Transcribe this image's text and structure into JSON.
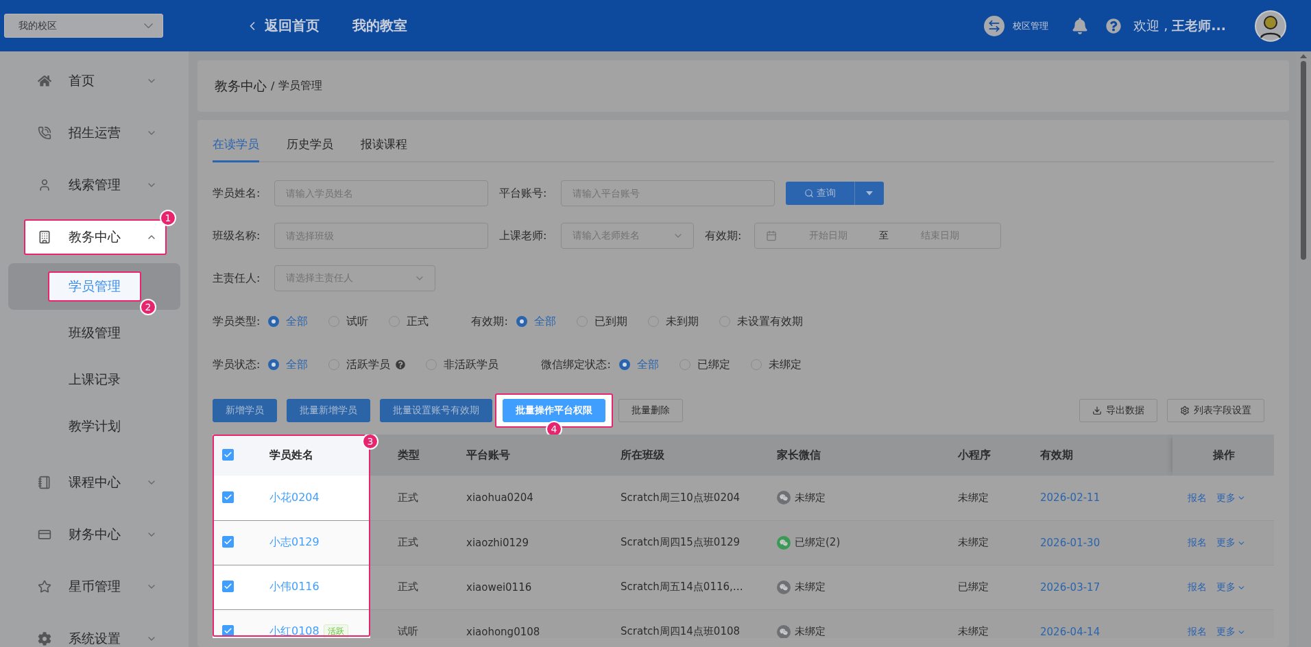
{
  "header": {
    "campus_select": "我的校区",
    "back": "返回首页",
    "nav_item": "我的教室",
    "campus_manage": "校区管理",
    "welcome": "欢迎 , **王老师...**"
  },
  "sidebar": [
    {
      "label": "首页",
      "expanded": false
    },
    {
      "label": "招生运营",
      "expanded": false
    },
    {
      "label": "线索管理",
      "expanded": false
    },
    {
      "label": "教务中心",
      "expanded": true,
      "step": "1",
      "children": [
        {
          "label": "学员管理",
          "selected": true,
          "step": "2"
        },
        {
          "label": "班级管理",
          "selected": false
        },
        {
          "label": "上课记录",
          "selected": false
        },
        {
          "label": "教学计划",
          "selected": false
        }
      ]
    },
    {
      "label": "课程中心",
      "expanded": false
    },
    {
      "label": "财务中心",
      "expanded": false
    },
    {
      "label": "星币管理",
      "expanded": false
    },
    {
      "label": "系统设置",
      "expanded": false
    }
  ],
  "breadcrumb": {
    "items": [
      "教务中心",
      "学员管理"
    ],
    "separator": "/"
  },
  "tabs": [
    {
      "label": "在读学员",
      "selected": true
    },
    {
      "label": "历史学员",
      "selected": false
    },
    {
      "label": "报读课程",
      "selected": false
    }
  ],
  "filters": [
    [
      {
        "label": "学员姓名:",
        "kind": "input",
        "placeholder": "请输入学员姓名"
      },
      {
        "label": "平台账号:",
        "kind": "input",
        "placeholder": "请输入平台账号"
      },
      {
        "kind": "query",
        "label": "查询"
      }
    ],
    [
      {
        "label": "班级名称:",
        "kind": "input",
        "placeholder": "请选择班级"
      },
      {
        "label": "上课老师:",
        "kind": "select",
        "placeholder": "请输入老师姓名"
      },
      {
        "label": "有效期:",
        "kind": "daterange",
        "start_placeholder": "开始日期",
        "separator": "至",
        "end_placeholder": "结束日期"
      }
    ],
    [
      {
        "label": "主责任人:",
        "kind": "select",
        "placeholder": "请选择主责任人"
      }
    ]
  ],
  "radio_rows": [
    [
      {
        "label": "学员类型:",
        "options": [
          {
            "label": "全部",
            "selected": true
          },
          {
            "label": "试听",
            "selected": false
          },
          {
            "label": "正式",
            "selected": false
          }
        ]
      },
      {
        "label": "有效期:",
        "options": [
          {
            "label": "全部",
            "selected": true
          },
          {
            "label": "已到期",
            "selected": false
          },
          {
            "label": "未到期",
            "selected": false
          },
          {
            "label": "未设置有效期",
            "selected": false
          }
        ]
      }
    ],
    [
      {
        "label": "学员状态:",
        "options": [
          {
            "label": "全部",
            "selected": true
          },
          {
            "label": "活跃学员",
            "selected": false,
            "help": true
          },
          {
            "label": "非活跃学员",
            "selected": false
          }
        ]
      },
      {
        "label": "微信绑定状态:",
        "options": [
          {
            "label": "全部",
            "selected": true
          },
          {
            "label": "已绑定",
            "selected": false
          },
          {
            "label": "未绑定",
            "selected": false
          }
        ]
      }
    ]
  ],
  "actions": {
    "left": [
      {
        "label": "新增学员",
        "kind": "primary"
      },
      {
        "label": "批量新增学员",
        "kind": "primary"
      },
      {
        "label": "批量设置账号有效期",
        "kind": "primary"
      },
      {
        "label": "批量操作平台权限",
        "kind": "primary",
        "step": "4"
      },
      {
        "label": "批量删除",
        "kind": "default"
      }
    ],
    "right": [
      "导出数据",
      "列表字段设置"
    ]
  },
  "table": {
    "step": "3",
    "all_checked": true,
    "columns": [
      "学员姓名",
      "类型",
      "平台账号",
      "所在班级",
      "家长微信",
      "小程序",
      "有效期",
      "操作"
    ],
    "rows": [
      {
        "checked": true,
        "name": "小花0204",
        "type": "正式",
        "account": "xiaohua0204",
        "class": "Scratch周三10点班0204",
        "wechat": "未绑定",
        "wechat_bound": false,
        "miniprogram": "未绑定",
        "expiry": "2026-02-11",
        "actions": [
          "报名",
          "更多"
        ]
      },
      {
        "checked": true,
        "name": "小志0129",
        "type": "正式",
        "account": "xiaozhi0129",
        "class": "Scratch周四15点班0129",
        "wechat": "已绑定(2)",
        "wechat_bound": true,
        "miniprogram": "未绑定",
        "expiry": "2026-01-30",
        "actions": [
          "报名",
          "更多"
        ]
      },
      {
        "checked": true,
        "name": "小伟0116",
        "type": "正式",
        "account": "xiaowei0116",
        "class": "Scratch周五14点0116,…",
        "wechat": "未绑定",
        "wechat_bound": false,
        "miniprogram": "已绑定",
        "expiry": "2026-03-17",
        "actions": [
          "报名",
          "更多"
        ]
      },
      {
        "checked": true,
        "name": "小红0108",
        "tag": "活跃",
        "type": "试听",
        "account": "xiaohong0108",
        "class": "Scratch周四14点班0108",
        "wechat": "未绑定",
        "wechat_bound": false,
        "miniprogram": "未绑定",
        "expiry": "2026-04-14",
        "actions": [
          "报名",
          "更多"
        ]
      }
    ]
  }
}
